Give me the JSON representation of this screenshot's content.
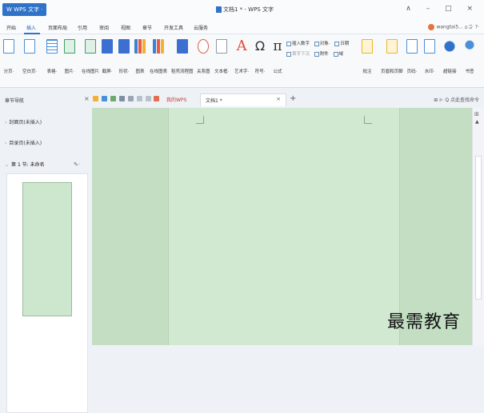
{
  "title": {
    "app_badge": "W WPS 文字 ·",
    "document": "文档1 * - WPS 文字",
    "window_controls": "∧ – □ ×"
  },
  "menu": {
    "items": [
      "开始",
      "插入",
      "页面布局",
      "引用",
      "审阅",
      "视图",
      "章节",
      "开发工具",
      "云服务"
    ],
    "active": "插入",
    "user": "wangtai5... ⌂  ⍈· ?·"
  },
  "ribbon": {
    "buttons": [
      {
        "label": "分页·",
        "icon": "page-break-icon"
      },
      {
        "label": "空白页·",
        "icon": "blank-page-icon"
      },
      {
        "label": "表格·",
        "icon": "table-icon"
      },
      {
        "label": "图片·",
        "icon": "picture-icon"
      },
      {
        "label": "在线图片",
        "icon": "online-picture-icon"
      },
      {
        "label": "截屏·",
        "icon": "screenshot-icon"
      },
      {
        "label": "形状·",
        "icon": "shape-icon"
      },
      {
        "label": "图表",
        "icon": "chart-icon"
      },
      {
        "label": "在线图表",
        "icon": "online-chart-icon"
      },
      {
        "label": "稻壳流程图",
        "icon": "flowchart-icon"
      },
      {
        "label": "关系图",
        "icon": "relation-icon"
      },
      {
        "label": "文本框·",
        "icon": "textbox-icon"
      },
      {
        "label": "艺术字·",
        "icon": "wordart-icon"
      },
      {
        "label": "符号·",
        "icon": "symbol-icon"
      },
      {
        "label": "公式",
        "icon": "formula-icon"
      }
    ],
    "mini": {
      "row1": [
        "插入数字",
        "对象·",
        "日期"
      ],
      "row2": [
        "首字下沉",
        "附件",
        "域"
      ]
    },
    "right_buttons": [
      {
        "label": "批注",
        "icon": "comment-icon"
      },
      {
        "label": "页眉和页脚",
        "icon": "header-footer-icon"
      },
      {
        "label": "页码·",
        "icon": "page-number-icon"
      },
      {
        "label": "水印·",
        "icon": "watermark-icon"
      },
      {
        "label": "超链接",
        "icon": "hyperlink-icon"
      },
      {
        "label": "书签",
        "icon": "bookmark-icon"
      },
      {
        "label": "文档",
        "icon": "document-icon"
      }
    ]
  },
  "toolbar": {
    "nav_title": "章节导航",
    "tab_wps": "我的WPS",
    "tab_doc": "文档1 *",
    "right_tools": "⊞ ⊩  Q 点此查找命令"
  },
  "nav": {
    "items": [
      "封面页(未插入)",
      "目录页(未插入)",
      "第 1 节: 未命名"
    ]
  },
  "watermark_text": "最需教育"
}
